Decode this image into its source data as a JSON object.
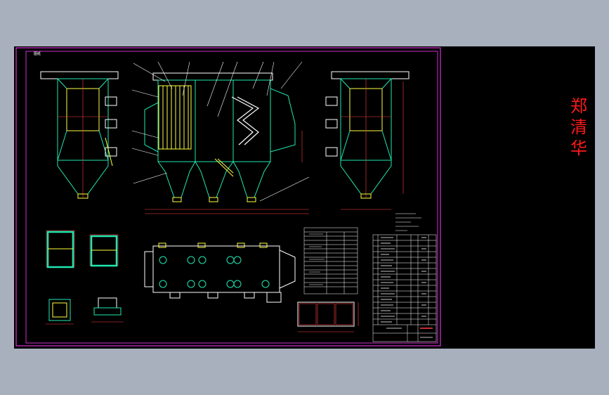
{
  "stamp": {
    "line1": "郑",
    "line2": "清",
    "line3": "华"
  },
  "drawing": {
    "frame_tag": "图纸",
    "colors": {
      "background": "#000000",
      "frame": "#ff3cff",
      "outline": "#20e8b0",
      "detail": "#ffff40",
      "dimension": "#ff4040",
      "text": "#ffffff",
      "stamp": "#ff1a1a",
      "surround": "#a8b0bd"
    }
  }
}
